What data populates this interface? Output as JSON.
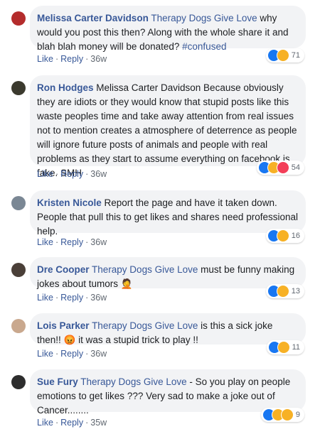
{
  "comments": [
    {
      "author": "Melissa Carter Davidson",
      "tag": "Therapy Dogs Give Love",
      "text": " why would you post this then? Along with the whole share it and blah blah money will be donated? ",
      "hashtag": "#confused",
      "time": "36w",
      "reaction_count": "71",
      "reactions": [
        "like-icon",
        "haha-icon"
      ]
    },
    {
      "author": "Ron Hodges",
      "tag": "",
      "text": " Melissa Carter Davidson Because obviously they are idiots or they would know that stupid posts like this waste peoples time and take away attention from real issues not to mention creates a atmosphere of deterrence as people will ignore future posts of animals and people with real problems as they start to assume everything on facebook is fake. SMH",
      "time": "36w",
      "reaction_count": "54",
      "reactions": [
        "like-icon",
        "haha-icon",
        "love-icon"
      ]
    },
    {
      "author": "Kristen Nicole",
      "tag": "",
      "text": " Report the page and have it taken down. People that pull this to get likes and shares need professional help.",
      "time": "36w",
      "reaction_count": "16",
      "reactions": [
        "like-icon",
        "haha-icon"
      ]
    },
    {
      "author": "Dre Cooper",
      "tag": "Therapy Dogs Give Love",
      "text": " must be funny making jokes about tumors 🤦",
      "time": "36w",
      "reaction_count": "13",
      "reactions": [
        "like-icon",
        "haha-icon"
      ]
    },
    {
      "author": "Lois Parker",
      "tag": "Therapy Dogs Give Love",
      "text": " is this a sick joke then!! 😡 it was a stupid trick to play !!",
      "time": "36w",
      "reaction_count": "11",
      "reactions": [
        "like-icon",
        "haha-icon"
      ]
    },
    {
      "author": "Sue Fury",
      "tag": "Therapy Dogs Give Love",
      "text": " - So you play on people emotions to get likes ??? Very sad to make a joke out of Cancer........",
      "time": "35w",
      "reaction_count": "9",
      "reactions": [
        "like-icon",
        "haha-icon",
        "wow-icon"
      ]
    }
  ],
  "labels": {
    "like": "Like",
    "reply": "Reply",
    "dot": "·"
  },
  "colors": {
    "link": "#385898",
    "bubble": "#f2f3f5",
    "meta": "#606770"
  }
}
